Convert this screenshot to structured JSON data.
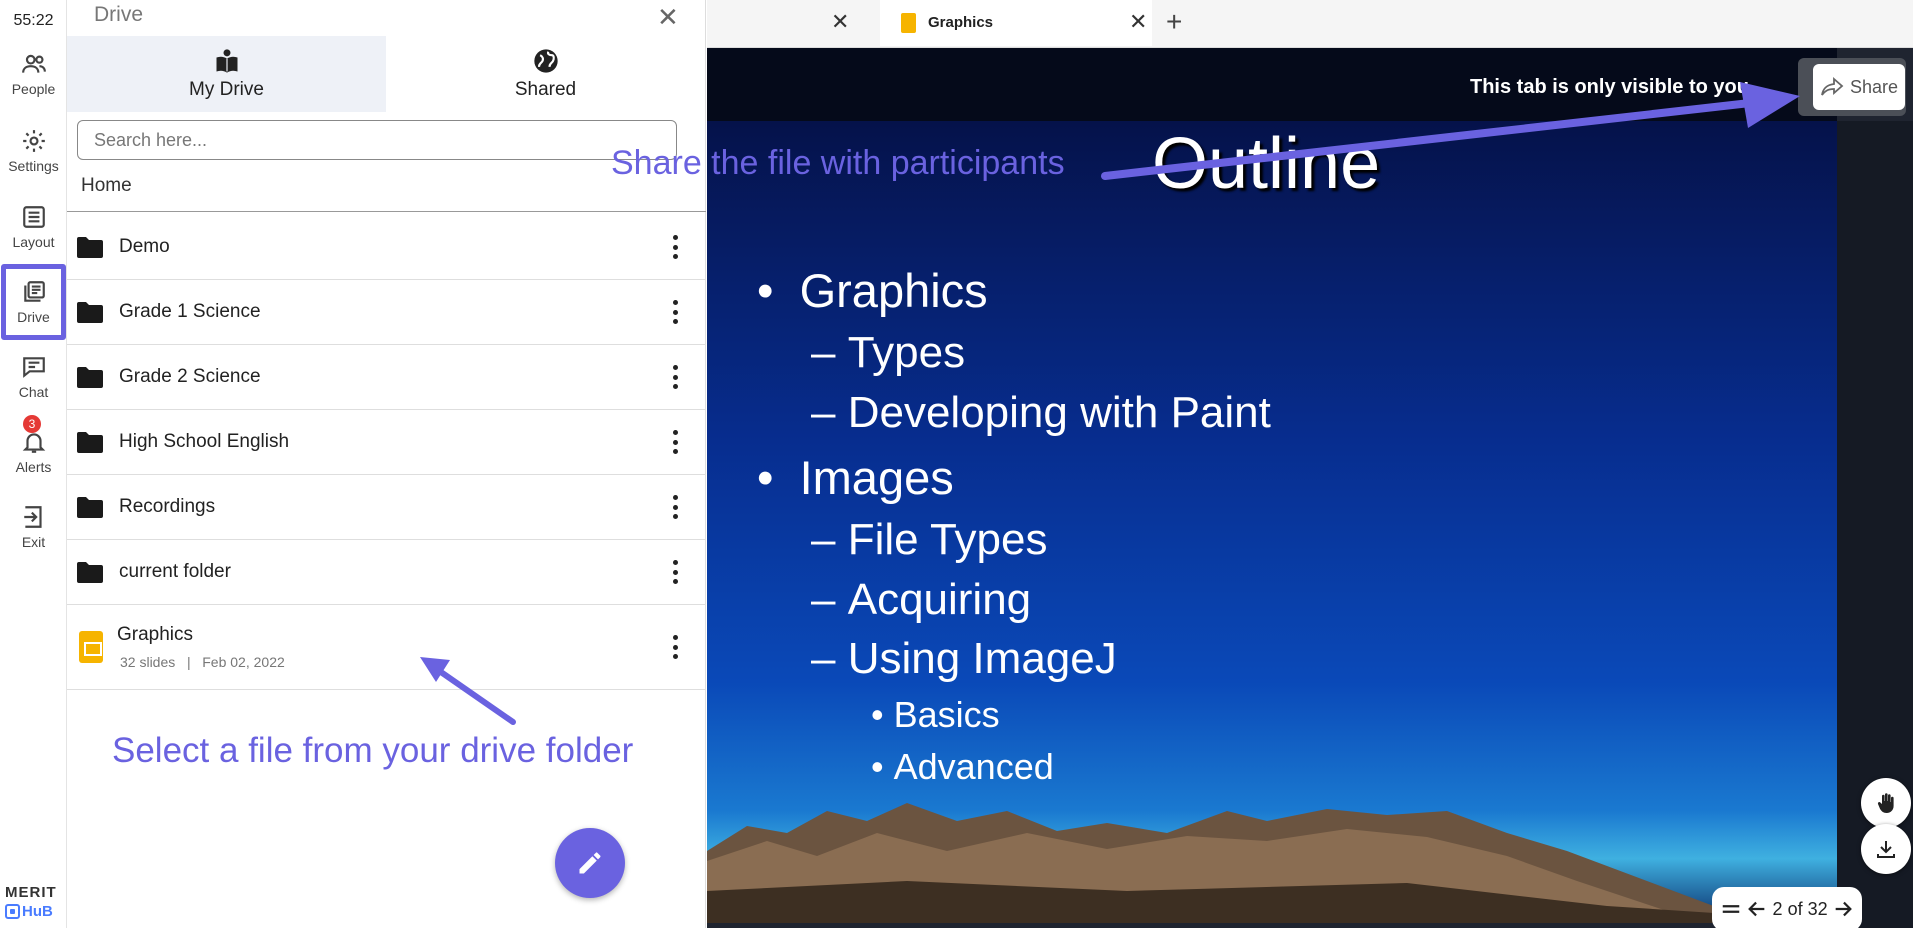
{
  "timer": "55:22",
  "rail": {
    "items": [
      {
        "label": "People",
        "icon": "people-icon"
      },
      {
        "label": "Settings",
        "icon": "gear-icon"
      },
      {
        "label": "Layout",
        "icon": "layout-icon"
      },
      {
        "label": "Drive",
        "icon": "drive-icon"
      },
      {
        "label": "Chat",
        "icon": "chat-icon"
      },
      {
        "label": "Alerts",
        "icon": "bell-icon",
        "badge": "3"
      },
      {
        "label": "Exit",
        "icon": "exit-icon"
      }
    ],
    "active": "Drive",
    "brand_top": "MERIT",
    "brand_bottom": "HuB"
  },
  "drive": {
    "title": "Drive",
    "tabs": [
      {
        "label": "My Drive",
        "icon": "book-user-icon"
      },
      {
        "label": "Shared",
        "icon": "globe-icon"
      }
    ],
    "active_tab": "My Drive",
    "search_placeholder": "Search here...",
    "breadcrumb": "Home",
    "folders": [
      {
        "name": "Demo"
      },
      {
        "name": "Grade 1 Science"
      },
      {
        "name": "Grade 2 Science"
      },
      {
        "name": "High School English"
      },
      {
        "name": "Recordings"
      },
      {
        "name": "current folder"
      }
    ],
    "file": {
      "name": "Graphics",
      "slides": "32 slides",
      "separator": "|",
      "date": "Feb 02, 2022"
    }
  },
  "annotations": {
    "select_hint": "Select a file from your drive folder",
    "share_hint": "Share the file with participants",
    "color": "#6a62e0"
  },
  "browser": {
    "active_tab_title": "Graphics",
    "new_tab_glyph": "+"
  },
  "viewer": {
    "banner_text": "This tab is only visible to you.",
    "share_label": "Share",
    "page_current": "2",
    "page_of": "of",
    "page_total": "32"
  },
  "slide": {
    "title": "Outline",
    "bullets": [
      {
        "level": 1,
        "marker": "•",
        "text": "Graphics"
      },
      {
        "level": 2,
        "marker": "–",
        "text": "Types"
      },
      {
        "level": 2,
        "marker": "–",
        "text": "Developing with Paint"
      },
      {
        "level": 1,
        "marker": "•",
        "text": "Images"
      },
      {
        "level": 2,
        "marker": "–",
        "text": "File Types"
      },
      {
        "level": 2,
        "marker": "–",
        "text": "Acquiring"
      },
      {
        "level": 2,
        "marker": "–",
        "text": "Using ImageJ"
      },
      {
        "level": 3,
        "marker": "•",
        "text": "Basics"
      },
      {
        "level": 3,
        "marker": "•",
        "text": "Advanced"
      }
    ]
  }
}
